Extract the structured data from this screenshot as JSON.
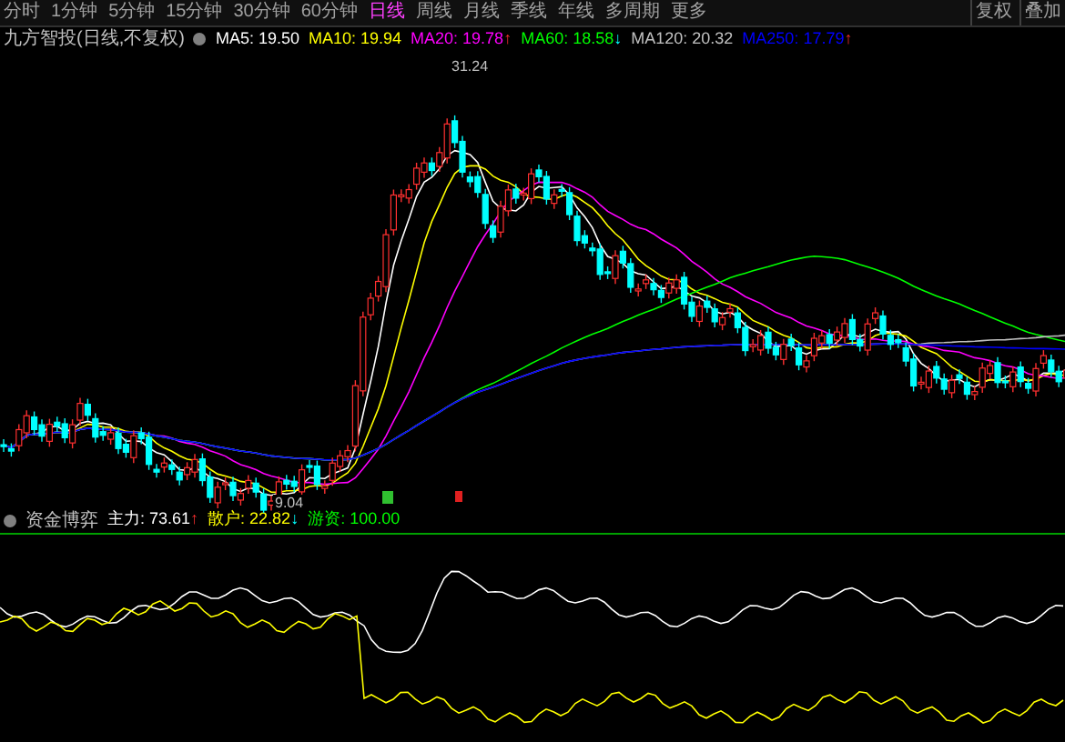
{
  "menu": [
    {
      "label": "分时",
      "selected": false
    },
    {
      "label": "1分钟",
      "selected": false
    },
    {
      "label": "5分钟",
      "selected": false
    },
    {
      "label": "15分钟",
      "selected": false
    },
    {
      "label": "30分钟",
      "selected": false
    },
    {
      "label": "60分钟",
      "selected": false
    },
    {
      "label": "日线",
      "selected": true
    },
    {
      "label": "周线",
      "selected": false
    },
    {
      "label": "月线",
      "selected": false
    },
    {
      "label": "季线",
      "selected": false
    },
    {
      "label": "年线",
      "selected": false
    },
    {
      "label": "多周期",
      "selected": false
    },
    {
      "label": "更多",
      "selected": false
    }
  ],
  "menu_right": [
    "复权",
    "叠加"
  ],
  "legend": {
    "title": "九方智投(日线,不复权)",
    "items": [
      {
        "label": "MA5: 19.50",
        "color": "#ffffff"
      },
      {
        "label": "MA10: 19.94",
        "color": "#ffff00"
      },
      {
        "label": "MA20: 19.78",
        "color": "#ff00ff",
        "arrow": "↑"
      },
      {
        "label": "MA60: 18.58",
        "color": "#00ff00",
        "arrow": "↓"
      },
      {
        "label": "MA120: 20.32",
        "color": "#c0c0c0"
      },
      {
        "label": "MA250: 17.79",
        "color": "#0000ff",
        "arrow": "↑"
      }
    ]
  },
  "chart": {
    "high_label": "31.24",
    "low_label": "9.04"
  },
  "indicator": {
    "title": "资金博弈",
    "items": [
      {
        "label": "主力: 73.61",
        "color": "#ffffff",
        "arrow": "↑"
      },
      {
        "label": "散户: 22.82",
        "color": "#ffff00",
        "arrow": "↓"
      },
      {
        "label": "游资: 100.00",
        "color": "#00ff00"
      }
    ]
  }
}
